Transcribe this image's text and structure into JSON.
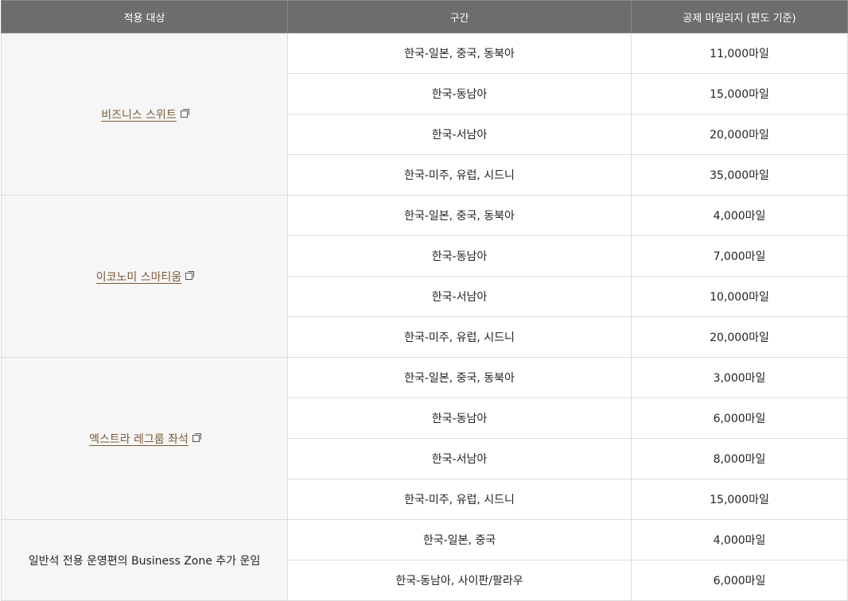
{
  "header": {
    "col_target": "적용 대상",
    "col_route": "구간",
    "col_miles": "공제 마일리지 (편도 기준)"
  },
  "groups": [
    {
      "target": "비즈니스 스위트",
      "is_link": true,
      "rows": [
        {
          "route": "한국-일본, 중국, 동북아",
          "miles": "11,000마일"
        },
        {
          "route": "한국-동남아",
          "miles": "15,000마일"
        },
        {
          "route": "한국-서남아",
          "miles": "20,000마일"
        },
        {
          "route": "한국-미주, 유럽, 시드니",
          "miles": "35,000마일"
        }
      ]
    },
    {
      "target": "이코노미 스마티움",
      "is_link": true,
      "rows": [
        {
          "route": "한국-일본, 중국, 동북아",
          "miles": "4,000마일"
        },
        {
          "route": "한국-동남아",
          "miles": "7,000마일"
        },
        {
          "route": "한국-서남아",
          "miles": "10,000마일"
        },
        {
          "route": "한국-미주, 유럽, 시드니",
          "miles": "20,000마일"
        }
      ]
    },
    {
      "target": "엑스트라 레그룸 좌석",
      "is_link": true,
      "rows": [
        {
          "route": "한국-일본, 중국, 동북아",
          "miles": "3,000마일"
        },
        {
          "route": "한국-동남아",
          "miles": "6,000마일"
        },
        {
          "route": "한국-서남아",
          "miles": "8,000마일"
        },
        {
          "route": "한국-미주, 유럽, 시드니",
          "miles": "15,000마일"
        }
      ]
    },
    {
      "target": "일반석 전용 운영편의 Business Zone 추가 운임",
      "is_link": false,
      "rows": [
        {
          "route": "한국-일본, 중국",
          "miles": "4,000마일"
        },
        {
          "route": "한국-동남아, 사이판/팔라우",
          "miles": "6,000마일"
        }
      ]
    }
  ]
}
